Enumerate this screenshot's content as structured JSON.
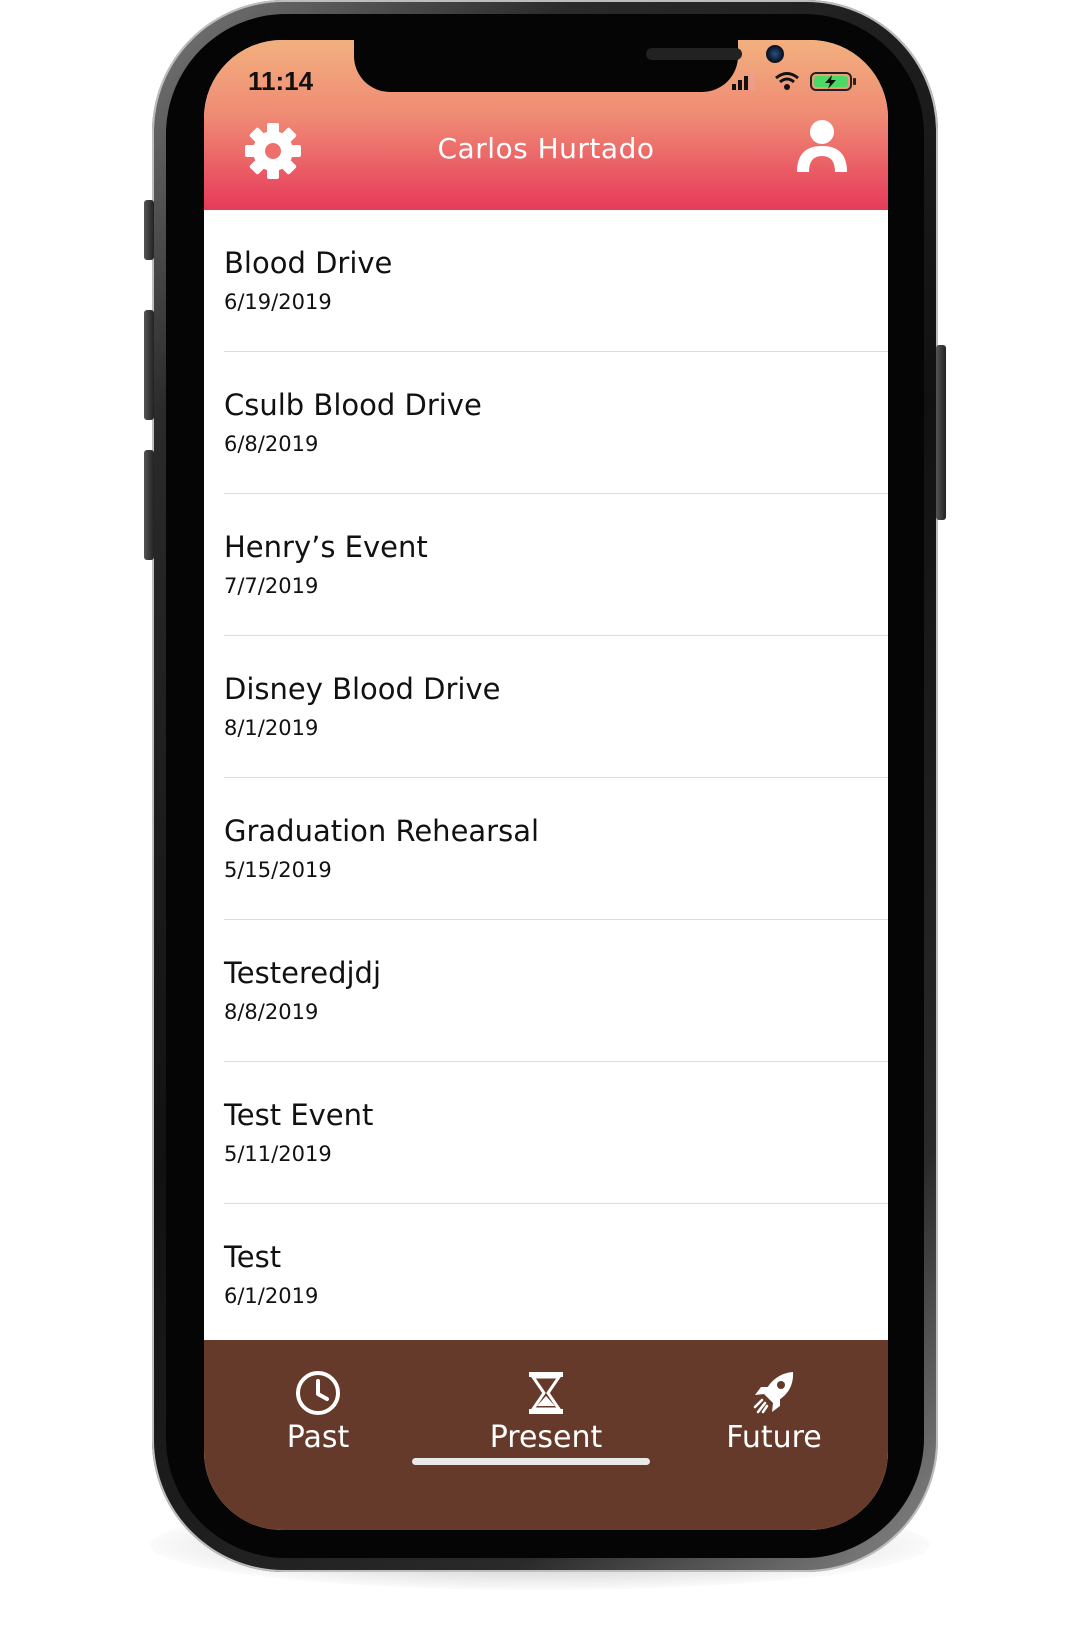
{
  "status_bar": {
    "time": "11:14"
  },
  "header": {
    "title": "Carlos  Hurtado",
    "settings_icon": "gear-icon",
    "profile_icon": "person-icon",
    "gradient": [
      "#f2b07e",
      "#e63a5a"
    ]
  },
  "events": [
    {
      "name": "Blood Drive",
      "date": "6/19/2019"
    },
    {
      "name": "Csulb Blood Drive",
      "date": "6/8/2019"
    },
    {
      "name": "Henry’s Event",
      "date": "7/7/2019"
    },
    {
      "name": "Disney Blood Drive",
      "date": "8/1/2019"
    },
    {
      "name": "Graduation Rehearsal",
      "date": "5/15/2019"
    },
    {
      "name": "Testeredjdj",
      "date": "8/8/2019"
    },
    {
      "name": "Test Event",
      "date": "5/11/2019"
    },
    {
      "name": "Test",
      "date": "6/1/2019"
    }
  ],
  "tab_bar": {
    "background": "#653a2b",
    "tabs": [
      {
        "label": "Past",
        "icon": "clock-icon"
      },
      {
        "label": "Present",
        "icon": "hourglass-icon"
      },
      {
        "label": "Future",
        "icon": "rocket-icon"
      }
    ]
  }
}
